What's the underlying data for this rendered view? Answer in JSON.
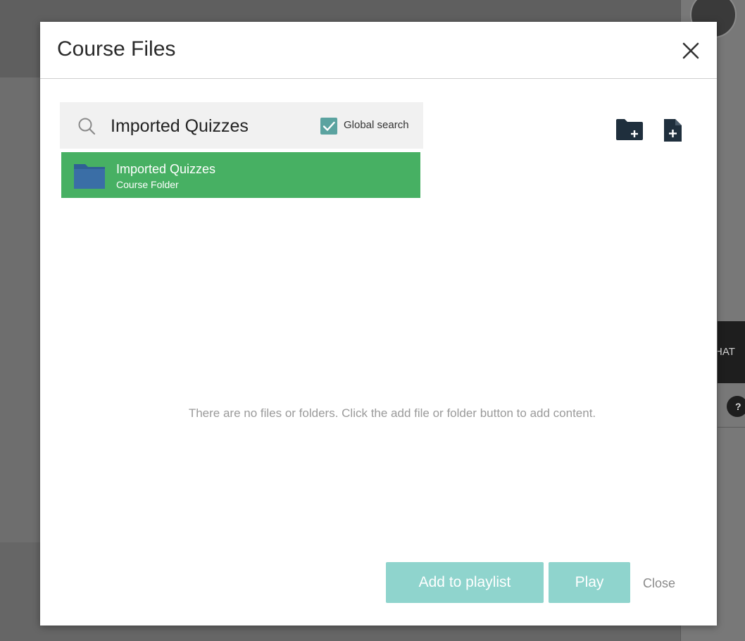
{
  "modal": {
    "title": "Course Files",
    "search": {
      "value": "Imported Quizzes",
      "global_search_label": "Global search",
      "global_search_checked": true
    },
    "results": [
      {
        "name": "Imported Quizzes",
        "type": "Course Folder"
      }
    ],
    "empty_message": "There are no files or folders. Click the add file or folder button to add content.",
    "buttons": {
      "add_to_playlist": "Add to playlist",
      "play": "Play",
      "close": "Close"
    },
    "icons": {
      "close": "close-icon",
      "search": "search-icon",
      "add_folder": "add-folder-icon",
      "add_file": "add-file-icon",
      "folder": "folder-icon",
      "checkbox": "checkmark-icon"
    }
  },
  "background": {
    "chat_tab": "HAT",
    "help": "?"
  },
  "colors": {
    "selected_row": "#47b063",
    "button_disabled": "#8fd4cd",
    "checkbox": "#5ba3a0",
    "icon_dark": "#1f2f3d",
    "folder_icon": "#2f5f95"
  }
}
